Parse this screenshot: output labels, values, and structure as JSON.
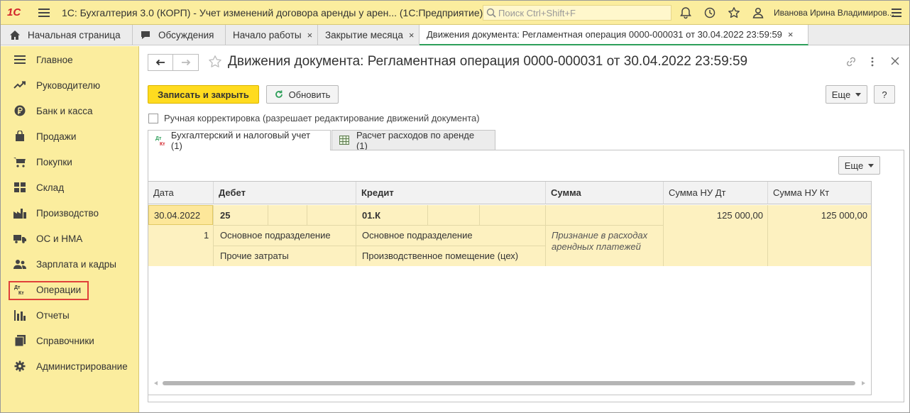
{
  "app": {
    "logo": "1С",
    "title": "1С: Бухгалтерия 3.0 (КОРП) - Учет изменений договора аренды у арен...  (1С:Предприятие)",
    "search_placeholder": "Поиск Ctrl+Shift+F",
    "user": "Иванова Ирина Владимиров..."
  },
  "tabs": [
    {
      "label": "Начальная страница"
    },
    {
      "label": "Обсуждения"
    },
    {
      "label": "Начало работы",
      "close": "×"
    },
    {
      "label": "Закрытие месяца",
      "close": "×"
    },
    {
      "label": "Движения документа: Регламентная операция 0000-000031 от 30.04.2022 23:59:59",
      "close": "×"
    }
  ],
  "sidebar": {
    "items": [
      {
        "label": "Главное",
        "icon": "menu-lines-icon"
      },
      {
        "label": "Руководителю",
        "icon": "trend-icon"
      },
      {
        "label": "Банк и касса",
        "icon": "ruble-coin-icon"
      },
      {
        "label": "Продажи",
        "icon": "shopping-bag-icon"
      },
      {
        "label": "Покупки",
        "icon": "cart-icon"
      },
      {
        "label": "Склад",
        "icon": "warehouse-grid-icon"
      },
      {
        "label": "Производство",
        "icon": "factory-icon"
      },
      {
        "label": "ОС и НМА",
        "icon": "truck-icon"
      },
      {
        "label": "Зарплата и кадры",
        "icon": "people-icon"
      },
      {
        "label": "Операции",
        "icon": "dt-kt-icon",
        "icon_text": "Дт Кт"
      },
      {
        "label": "Отчеты",
        "icon": "bar-chart-icon"
      },
      {
        "label": "Справочники",
        "icon": "books-icon"
      },
      {
        "label": "Администрирование",
        "icon": "gear-icon"
      }
    ],
    "selected": "Операции",
    "highlight_color": "#e0403a"
  },
  "document": {
    "title": "Движения документа: Регламентная операция 0000-000031 от 30.04.2022 23:59:59",
    "save_close": "Записать и закрыть",
    "refresh": "Обновить",
    "more": "Еще",
    "help": "?",
    "manual_adjust": "Ручная корректировка (разрешает редактирование движений документа)",
    "form_tabs": [
      {
        "label": "Бухгалтерский и налоговый учет (1)",
        "icon_text": "Дт Кт"
      },
      {
        "label": "Расчет расходов по аренде (1)"
      }
    ],
    "table_more": "Еще"
  },
  "table": {
    "columns": [
      "Дата",
      "Дебет",
      "Кредит",
      "Сумма",
      "Сумма НУ Дт",
      "Сумма НУ Кт"
    ],
    "rows": [
      {
        "date": "30.04.2022",
        "num": "1",
        "debit_account": "25",
        "debit_sub1": "Основное подразделение",
        "debit_sub2": "Прочие затраты",
        "credit_account": "01.К",
        "credit_sub1": "Основное подразделение",
        "credit_sub2": "Производственное помещение (цех)",
        "content": "Признание в расходах арендных платежей",
        "sum_nu_dt": "125 000,00",
        "sum_nu_kt": "125 000,00"
      }
    ]
  },
  "colors": {
    "accent_yellow": "#fbed9e",
    "button_primary": "#ffdb1f",
    "active_tab_underline": "#2e9f5a",
    "row_selected": "#fdf1c0"
  }
}
